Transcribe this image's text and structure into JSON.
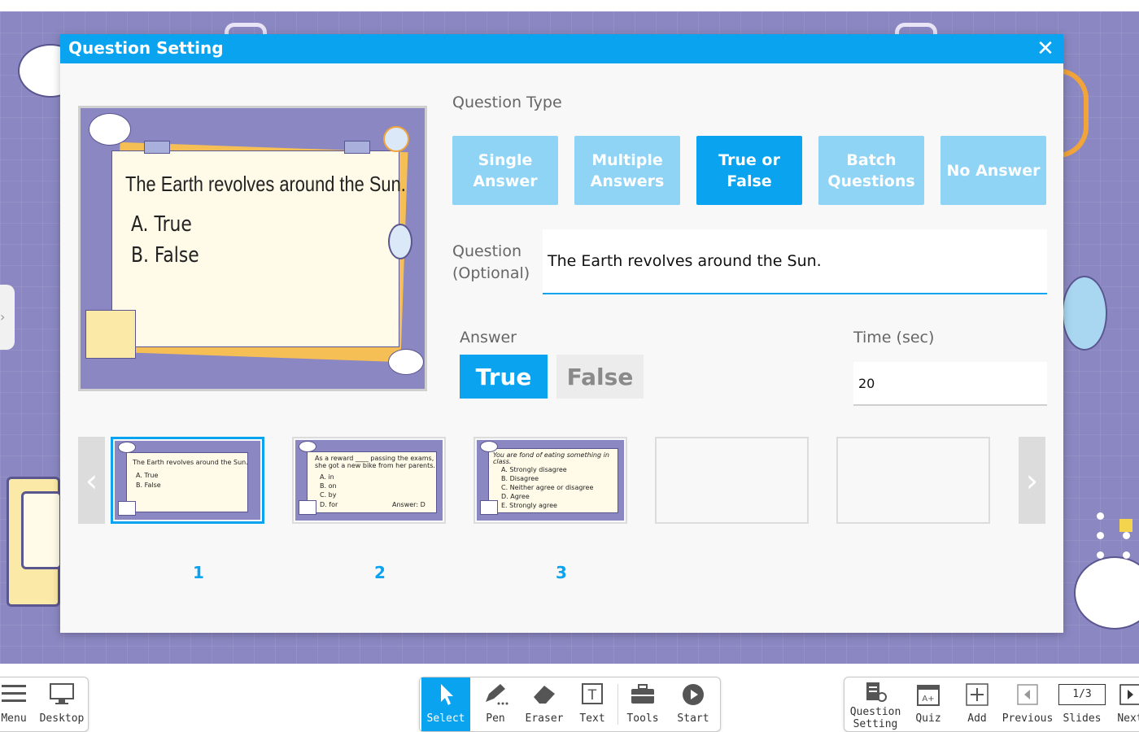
{
  "dialog": {
    "title": "Question Setting",
    "close_glyph": "✕"
  },
  "preview": {
    "question": "The Earth revolves around the Sun.",
    "options": [
      "A. True",
      "B. False"
    ]
  },
  "question_type": {
    "label": "Question Type",
    "buttons": [
      {
        "label": "Single Answer",
        "active": false
      },
      {
        "label": "Multiple Answers",
        "active": false
      },
      {
        "label": "True or False",
        "active": true
      },
      {
        "label": "Batch Questions",
        "active": false
      },
      {
        "label": "No Answer",
        "active": false
      }
    ]
  },
  "question": {
    "label": "Question (Optional)",
    "value": "The Earth revolves around the Sun."
  },
  "answer": {
    "label": "Answer",
    "options": [
      "True",
      "False"
    ],
    "selected": "True"
  },
  "time": {
    "label": "Time (sec)",
    "value": "20"
  },
  "thumbnails": {
    "prev_glyph": "‹",
    "next_glyph": "›",
    "slides": [
      {
        "number": "1",
        "selected": true,
        "lines": [
          "The Earth revolves around the Sun.",
          "A. True",
          "B. False"
        ],
        "answer": ""
      },
      {
        "number": "2",
        "selected": false,
        "lines": [
          "As a reward ____ passing the exams,",
          "she got a new bike from her parents.",
          "A. in",
          "B. on",
          "C. by",
          "D. for"
        ],
        "answer": "Answer: D"
      },
      {
        "number": "3",
        "selected": false,
        "lines": [
          "You are fond of eating something in",
          "class.",
          "A. Strongly disagree",
          "B. Disagree",
          "C. Neither agree or disagree",
          "D. Agree",
          "E. Strongly agree"
        ],
        "answer": ""
      }
    ]
  },
  "toolbar": {
    "left": [
      {
        "label": "Menu",
        "icon": "menu-icon"
      },
      {
        "label": "Desktop",
        "icon": "desktop-icon"
      }
    ],
    "center": [
      {
        "label": "Select",
        "icon": "cursor-icon",
        "active": true
      },
      {
        "label": "Pen",
        "icon": "pen-icon"
      },
      {
        "label": "Eraser",
        "icon": "eraser-icon"
      },
      {
        "label": "Text",
        "icon": "text-icon"
      },
      {
        "label": "Tools",
        "icon": "toolbox-icon"
      },
      {
        "label": "Start",
        "icon": "play-icon"
      }
    ],
    "right": [
      {
        "label": "Question Setting",
        "icon": "question-setting-icon"
      },
      {
        "label": "Quiz",
        "icon": "quiz-icon"
      },
      {
        "label": "Add",
        "icon": "plus-icon"
      },
      {
        "label": "Previous",
        "icon": "previous-icon"
      },
      {
        "label": "Slides",
        "icon": "slides-counter",
        "counter": "1/3"
      },
      {
        "label": "Next",
        "icon": "next-icon"
      }
    ]
  },
  "colors": {
    "accent": "#0aa3f0",
    "accent_light": "#8fd3f5",
    "slide_bg": "#8b87c2",
    "paper": "#fffbe8"
  }
}
